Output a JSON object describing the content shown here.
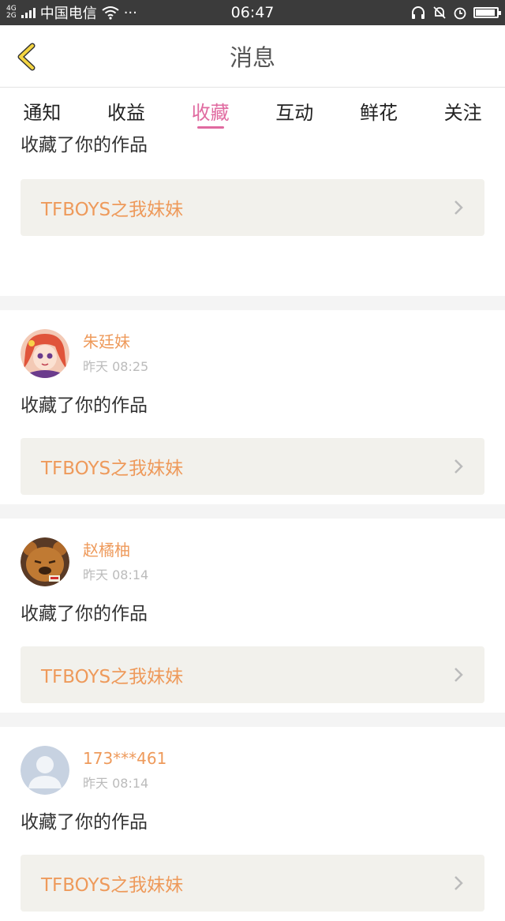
{
  "status_bar": {
    "network_top": "4G",
    "network_bottom": "2G",
    "carrier": "中国电信",
    "more": "···",
    "time": "06:47",
    "battery_level": 0.95
  },
  "header": {
    "title": "消息"
  },
  "tabs": [
    {
      "label": "通知"
    },
    {
      "label": "收益"
    },
    {
      "label": "收藏",
      "active": true
    },
    {
      "label": "互动"
    },
    {
      "label": "鲜花"
    },
    {
      "label": "关注"
    }
  ],
  "items": [
    {
      "action": "收藏了你的作品",
      "work": "TFBOYS之我妹妹"
    },
    {
      "user": "朱廷妹",
      "time": "昨天 08:25",
      "action": "收藏了你的作品",
      "work": "TFBOYS之我妹妹",
      "avatar": "anime-girl-avatar"
    },
    {
      "user": "赵橘柚",
      "time": "昨天 08:14",
      "action": "收藏了你的作品",
      "work": "TFBOYS之我妹妹",
      "avatar": "bear-avatar"
    },
    {
      "user": "173***461",
      "time": "昨天 08:14",
      "action": "收藏了你的作品",
      "work": "TFBOYS之我妹妹",
      "avatar": "default-avatar"
    }
  ],
  "colors": {
    "accent_pink": "#e06aa0",
    "username_orange": "#ee9a5b",
    "back_arrow_yellow": "#f4d542"
  }
}
